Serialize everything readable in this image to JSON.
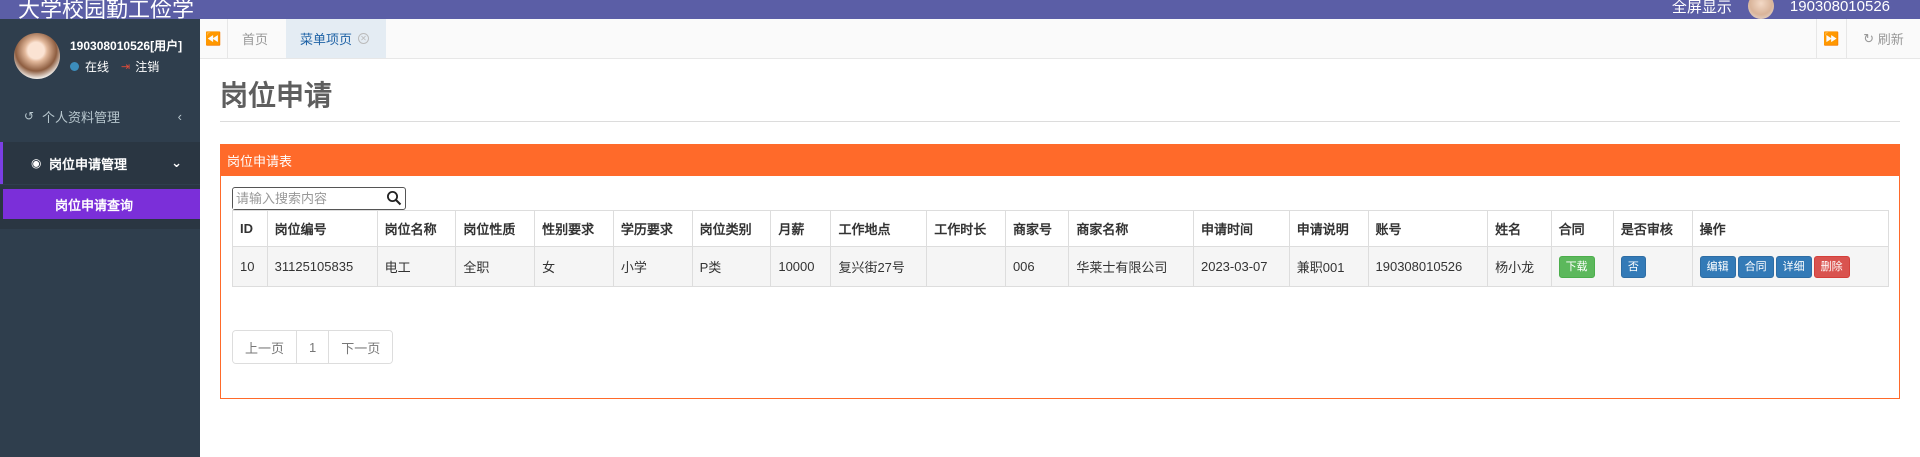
{
  "topbar": {
    "brand": "大学校园勤工俭学",
    "fullscreen": "全屏显示",
    "user": "190308010526"
  },
  "user": {
    "name": "190308010526[用户]",
    "status": "在线",
    "logout": "注销"
  },
  "sidebar": {
    "items": [
      {
        "label": "个人资料管理"
      },
      {
        "label": "岗位申请管理"
      }
    ],
    "submenu": {
      "label": "岗位申请查询"
    }
  },
  "tabs": {
    "home": "首页",
    "active": "菜单项页",
    "refresh": "刷新"
  },
  "page": {
    "title": "岗位申请"
  },
  "panel": {
    "title": "岗位申请表"
  },
  "search": {
    "placeholder": "请输入搜索内容"
  },
  "table": {
    "columns": [
      "ID",
      "岗位编号",
      "岗位名称",
      "岗位性质",
      "性别要求",
      "学历要求",
      "岗位类别",
      "月薪",
      "工作地点",
      "工作时长",
      "商家号",
      "商家名称",
      "申请时间",
      "申请说明",
      "账号",
      "姓名",
      "合同",
      "是否审核",
      "操作"
    ],
    "rows": [
      {
        "cells": [
          "10",
          "31125105835",
          "电工",
          "全职",
          "女",
          "小学",
          "P类",
          "10000",
          "复兴街27号",
          "",
          "006",
          "华莱士有限公司",
          "2023-03-07",
          "兼职001",
          "190308010526",
          "杨小龙"
        ],
        "contract": "下载",
        "audit": "否",
        "actions": [
          "编辑",
          "合同",
          "详细",
          "删除"
        ]
      }
    ]
  },
  "pager": {
    "prev": "上一页",
    "page": "1",
    "next": "下一页"
  },
  "colors": {
    "topbar": "#5b5ea6",
    "sidebar": "#2f3e4d",
    "submenu_active": "#7b2fd9",
    "panel_accent": "#ff6a2a",
    "btn_green": "#5cb85c",
    "btn_blue": "#337ab7",
    "btn_red": "#d9534f"
  }
}
